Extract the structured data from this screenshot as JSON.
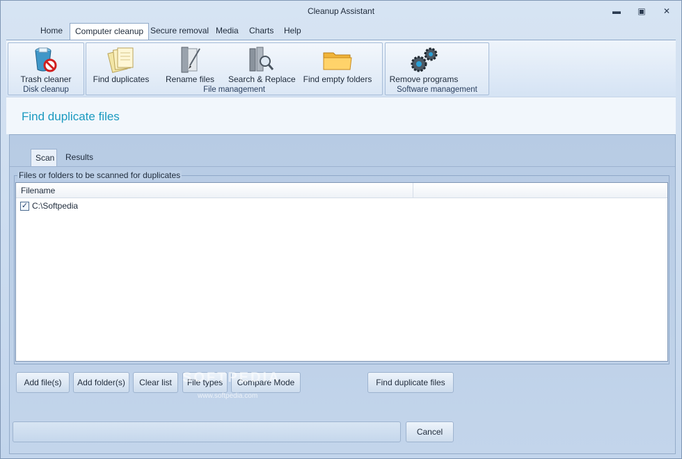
{
  "window": {
    "title": "Cleanup Assistant"
  },
  "menu": {
    "items": [
      "Home",
      "Computer cleanup",
      "Secure removal",
      "Media",
      "Charts",
      "Help"
    ],
    "active": "Computer cleanup"
  },
  "ribbon": {
    "groups": [
      {
        "label": "Disk cleanup",
        "buttons": [
          {
            "label": "Trash cleaner",
            "icon": "trash-cleaner-icon"
          }
        ]
      },
      {
        "label": "File management",
        "buttons": [
          {
            "label": "Find duplicates",
            "icon": "documents-icon"
          },
          {
            "label": "Rename files",
            "icon": "rename-icon"
          },
          {
            "label": "Search & Replace",
            "icon": "search-replace-icon"
          },
          {
            "label": "Find empty folders",
            "icon": "folder-icon"
          }
        ]
      },
      {
        "label": "Software management",
        "buttons": [
          {
            "label": "Remove programs",
            "icon": "gears-icon"
          }
        ]
      }
    ]
  },
  "page": {
    "title": "Find duplicate files"
  },
  "tabs": [
    "Scan",
    "Results"
  ],
  "scan": {
    "legend": "Files or folders to be scanned for duplicates",
    "columns": [
      "Filename",
      ""
    ],
    "rows": [
      {
        "checked": true,
        "name": "C:\\Softpedia"
      }
    ]
  },
  "buttons": {
    "add_files": "Add file(s)",
    "add_folders": "Add folder(s)",
    "clear_list": "Clear list",
    "file_types": "File types",
    "compare_mode": "Compare Mode",
    "find": "Find duplicate files",
    "cancel": "Cancel"
  },
  "watermark": {
    "text": "SOFTPEDIA",
    "url": "www.softpedia.com"
  },
  "colors": {
    "accent": "#1b9ac0",
    "window_bg": "#c2d5ec",
    "panel_bg": "#f2f7fc"
  }
}
